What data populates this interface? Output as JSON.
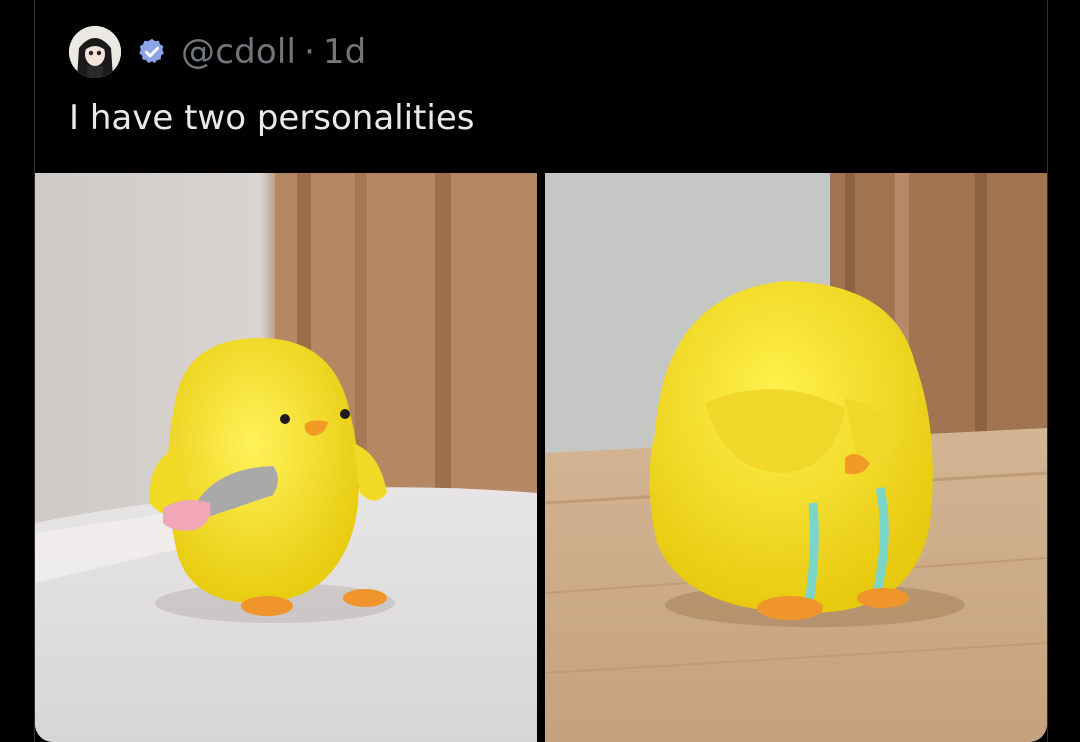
{
  "tweet": {
    "handle": "@cdoll",
    "separator": "·",
    "time": "1d",
    "text": "I have two personalities",
    "verified": true
  },
  "icons": {
    "avatar": "profile-avatar",
    "verified": "verified-badge-icon"
  },
  "media": {
    "count": 2,
    "items": [
      {
        "name": "felt-chick-with-knife"
      },
      {
        "name": "felt-chick-hiding-face"
      }
    ]
  },
  "colors": {
    "background": "#000000",
    "text_primary": "#e7e9ea",
    "text_secondary": "#71767b",
    "verified": "#8da3e8"
  }
}
